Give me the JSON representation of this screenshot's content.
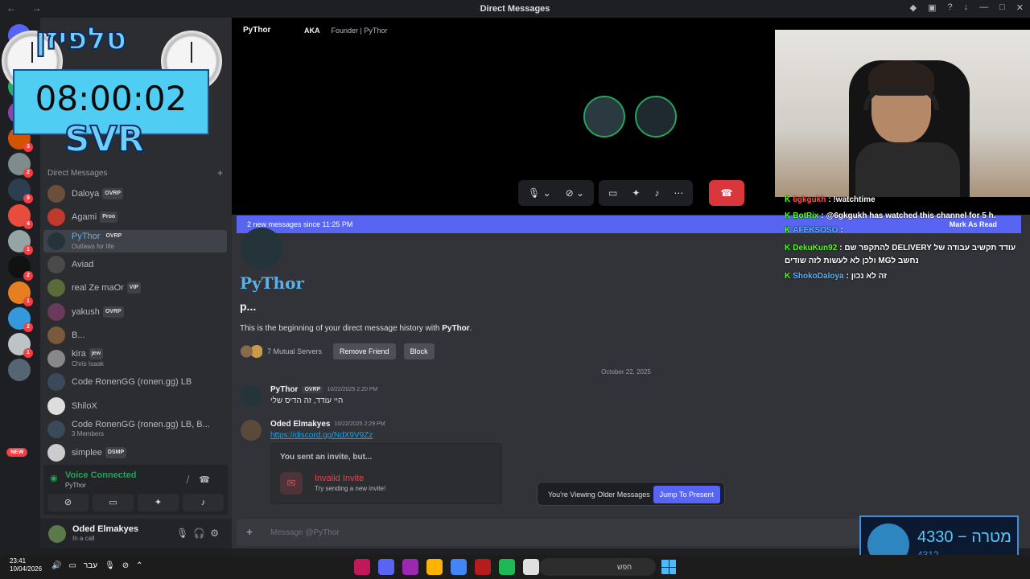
{
  "titlebar": {
    "title": "Direct Messages",
    "nav": "← →"
  },
  "overlay": {
    "logo": "טלפיזן",
    "timer": "08:00:02",
    "svr": "SVR"
  },
  "servers": [
    {
      "color": "#5865f2",
      "badge": ""
    },
    {
      "color": "#c0392b",
      "badge": "1"
    },
    {
      "color": "#27ae60",
      "badge": "6"
    },
    {
      "color": "#8e44ad",
      "badge": "2"
    },
    {
      "color": "#d35400",
      "badge": "3"
    },
    {
      "color": "#7f8c8d",
      "badge": "2"
    },
    {
      "color": "#2c3e50",
      "badge": "9"
    },
    {
      "color": "#e74c3c",
      "badge": "4"
    },
    {
      "color": "#95a5a6",
      "badge": "1"
    },
    {
      "color": "#111111",
      "badge": "2"
    },
    {
      "color": "#e67e22",
      "badge": "1"
    },
    {
      "color": "#3498db",
      "badge": "2"
    },
    {
      "color": "#bdc3c7",
      "badge": "1"
    },
    {
      "color": "#566573",
      "badge": ""
    }
  ],
  "new_badge": "NEW",
  "dm": {
    "header": "Direct Messages",
    "plus": "+",
    "items": [
      {
        "name": "Daloya",
        "tag": "OVRP",
        "sub": "",
        "color": "#6b4f3a"
      },
      {
        "name": "Agami",
        "tag": "Proo",
        "sub": "",
        "color": "#c0392b"
      },
      {
        "name": "PyThor",
        "tag": "OVRP",
        "sub": "Outlaws for life",
        "color": "#24343a",
        "active": true
      },
      {
        "name": "Aviad",
        "tag": "",
        "sub": "",
        "color": "#4a4a4a"
      },
      {
        "name": "real Ze maOr",
        "tag": "VIP",
        "sub": "",
        "color": "#5a6b3a"
      },
      {
        "name": "yakush",
        "tag": "OVRP",
        "sub": "",
        "color": "#6b3a5a"
      },
      {
        "name": "B...",
        "tag": "",
        "sub": "",
        "color": "#7a5a3a"
      },
      {
        "name": "kira",
        "tag": "jew",
        "sub": "Chris Isaak",
        "color": "#888888"
      },
      {
        "name": "Code RonenGG (ronen.gg) LB",
        "tag": "",
        "sub": "",
        "color": "#3a4a5a"
      },
      {
        "name": "ShiloX",
        "tag": "",
        "sub": "",
        "color": "#dddddd"
      },
      {
        "name": "Code RonenGG (ronen.gg) LB, B...",
        "tag": "",
        "sub": "3 Members",
        "color": "#3a4a5a"
      },
      {
        "name": "simplee",
        "tag": "DSMP",
        "sub": "",
        "color": "#cccccc"
      }
    ]
  },
  "voice": {
    "status": "Voice Connected",
    "channel": "PyThor"
  },
  "user": {
    "name": "Oded Elmakyes",
    "status": "In a call"
  },
  "call": {
    "name": "PyThor",
    "aka": "AKA",
    "founder": "Founder | PyThor"
  },
  "new_messages": {
    "text": "2 new messages since 11:25 PM",
    "mark": "Mark As Read"
  },
  "profile": {
    "name": "PyThor",
    "sub": "p...",
    "begin_prefix": "This is the beginning of your direct message history with ",
    "begin_name": "PyThor",
    "begin_suffix": ".",
    "mutual": "7 Mutual Servers",
    "remove": "Remove Friend",
    "block": "Block"
  },
  "date_divider": "October 22, 2025",
  "messages": [
    {
      "author": "PyThor",
      "tag": "OVRP",
      "time": "10/22/2025 2:20 PM",
      "body": "היי עודד, זה הדיס שלי"
    },
    {
      "author": "Oded Elmakyes",
      "time": "10/22/2025 2:29 PM",
      "link": "https://discord.gg/NdX9V9Zz"
    }
  ],
  "invite": {
    "header": "You sent an invite, but...",
    "title": "Invalid Invite",
    "sub": "Try sending a new invite!"
  },
  "older": {
    "text": "You're Viewing Older Messages",
    "button": "Jump To Present"
  },
  "composer": {
    "placeholder": "Message @PyThor",
    "plus": "+"
  },
  "chat": [
    {
      "user": "6gkgukh",
      "text": ": !watchtime",
      "cls": "cr"
    },
    {
      "user": "BotRix",
      "text": ": @6gkgukh has watched this channel for 5 h.",
      "cls": "cu"
    },
    {
      "user": "AFEKSOSO",
      "text": ":",
      "cls": "cb"
    },
    {
      "user": "DekuKun92",
      "text": ": להתקפר שם DELIVERY עודד תקשיב עבודה של",
      "cls": "cu"
    },
    {
      "user": "",
      "text": "ולכן לא לעשות לזה שודים MGנחשב ל",
      "cls": "cu"
    },
    {
      "user": "ShokoDaloya",
      "text": ": זה לא נכון",
      "cls": "cb"
    }
  ],
  "goal": {
    "value": "4330",
    "label": "מטרה",
    "sub": "4312"
  },
  "taskbar": {
    "time": "23:41",
    "date": "10/04/2026",
    "lang": "עבר",
    "search": "חפש"
  }
}
